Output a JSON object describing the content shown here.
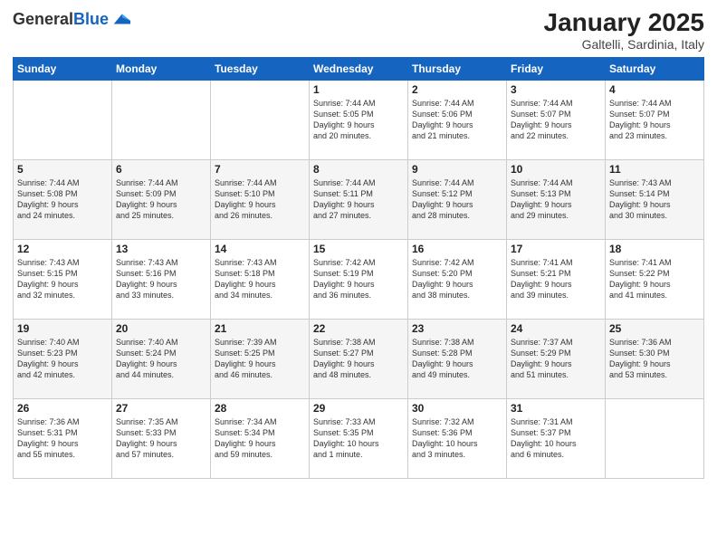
{
  "logo": {
    "general": "General",
    "blue": "Blue"
  },
  "header": {
    "title": "January 2025",
    "subtitle": "Galtelli, Sardinia, Italy"
  },
  "days_of_week": [
    "Sunday",
    "Monday",
    "Tuesday",
    "Wednesday",
    "Thursday",
    "Friday",
    "Saturday"
  ],
  "weeks": [
    [
      {
        "day": "",
        "info": ""
      },
      {
        "day": "",
        "info": ""
      },
      {
        "day": "",
        "info": ""
      },
      {
        "day": "1",
        "info": "Sunrise: 7:44 AM\nSunset: 5:05 PM\nDaylight: 9 hours\nand 20 minutes."
      },
      {
        "day": "2",
        "info": "Sunrise: 7:44 AM\nSunset: 5:06 PM\nDaylight: 9 hours\nand 21 minutes."
      },
      {
        "day": "3",
        "info": "Sunrise: 7:44 AM\nSunset: 5:07 PM\nDaylight: 9 hours\nand 22 minutes."
      },
      {
        "day": "4",
        "info": "Sunrise: 7:44 AM\nSunset: 5:07 PM\nDaylight: 9 hours\nand 23 minutes."
      }
    ],
    [
      {
        "day": "5",
        "info": "Sunrise: 7:44 AM\nSunset: 5:08 PM\nDaylight: 9 hours\nand 24 minutes."
      },
      {
        "day": "6",
        "info": "Sunrise: 7:44 AM\nSunset: 5:09 PM\nDaylight: 9 hours\nand 25 minutes."
      },
      {
        "day": "7",
        "info": "Sunrise: 7:44 AM\nSunset: 5:10 PM\nDaylight: 9 hours\nand 26 minutes."
      },
      {
        "day": "8",
        "info": "Sunrise: 7:44 AM\nSunset: 5:11 PM\nDaylight: 9 hours\nand 27 minutes."
      },
      {
        "day": "9",
        "info": "Sunrise: 7:44 AM\nSunset: 5:12 PM\nDaylight: 9 hours\nand 28 minutes."
      },
      {
        "day": "10",
        "info": "Sunrise: 7:44 AM\nSunset: 5:13 PM\nDaylight: 9 hours\nand 29 minutes."
      },
      {
        "day": "11",
        "info": "Sunrise: 7:43 AM\nSunset: 5:14 PM\nDaylight: 9 hours\nand 30 minutes."
      }
    ],
    [
      {
        "day": "12",
        "info": "Sunrise: 7:43 AM\nSunset: 5:15 PM\nDaylight: 9 hours\nand 32 minutes."
      },
      {
        "day": "13",
        "info": "Sunrise: 7:43 AM\nSunset: 5:16 PM\nDaylight: 9 hours\nand 33 minutes."
      },
      {
        "day": "14",
        "info": "Sunrise: 7:43 AM\nSunset: 5:18 PM\nDaylight: 9 hours\nand 34 minutes."
      },
      {
        "day": "15",
        "info": "Sunrise: 7:42 AM\nSunset: 5:19 PM\nDaylight: 9 hours\nand 36 minutes."
      },
      {
        "day": "16",
        "info": "Sunrise: 7:42 AM\nSunset: 5:20 PM\nDaylight: 9 hours\nand 38 minutes."
      },
      {
        "day": "17",
        "info": "Sunrise: 7:41 AM\nSunset: 5:21 PM\nDaylight: 9 hours\nand 39 minutes."
      },
      {
        "day": "18",
        "info": "Sunrise: 7:41 AM\nSunset: 5:22 PM\nDaylight: 9 hours\nand 41 minutes."
      }
    ],
    [
      {
        "day": "19",
        "info": "Sunrise: 7:40 AM\nSunset: 5:23 PM\nDaylight: 9 hours\nand 42 minutes."
      },
      {
        "day": "20",
        "info": "Sunrise: 7:40 AM\nSunset: 5:24 PM\nDaylight: 9 hours\nand 44 minutes."
      },
      {
        "day": "21",
        "info": "Sunrise: 7:39 AM\nSunset: 5:25 PM\nDaylight: 9 hours\nand 46 minutes."
      },
      {
        "day": "22",
        "info": "Sunrise: 7:38 AM\nSunset: 5:27 PM\nDaylight: 9 hours\nand 48 minutes."
      },
      {
        "day": "23",
        "info": "Sunrise: 7:38 AM\nSunset: 5:28 PM\nDaylight: 9 hours\nand 49 minutes."
      },
      {
        "day": "24",
        "info": "Sunrise: 7:37 AM\nSunset: 5:29 PM\nDaylight: 9 hours\nand 51 minutes."
      },
      {
        "day": "25",
        "info": "Sunrise: 7:36 AM\nSunset: 5:30 PM\nDaylight: 9 hours\nand 53 minutes."
      }
    ],
    [
      {
        "day": "26",
        "info": "Sunrise: 7:36 AM\nSunset: 5:31 PM\nDaylight: 9 hours\nand 55 minutes."
      },
      {
        "day": "27",
        "info": "Sunrise: 7:35 AM\nSunset: 5:33 PM\nDaylight: 9 hours\nand 57 minutes."
      },
      {
        "day": "28",
        "info": "Sunrise: 7:34 AM\nSunset: 5:34 PM\nDaylight: 9 hours\nand 59 minutes."
      },
      {
        "day": "29",
        "info": "Sunrise: 7:33 AM\nSunset: 5:35 PM\nDaylight: 10 hours\nand 1 minute."
      },
      {
        "day": "30",
        "info": "Sunrise: 7:32 AM\nSunset: 5:36 PM\nDaylight: 10 hours\nand 3 minutes."
      },
      {
        "day": "31",
        "info": "Sunrise: 7:31 AM\nSunset: 5:37 PM\nDaylight: 10 hours\nand 6 minutes."
      },
      {
        "day": "",
        "info": ""
      }
    ]
  ]
}
